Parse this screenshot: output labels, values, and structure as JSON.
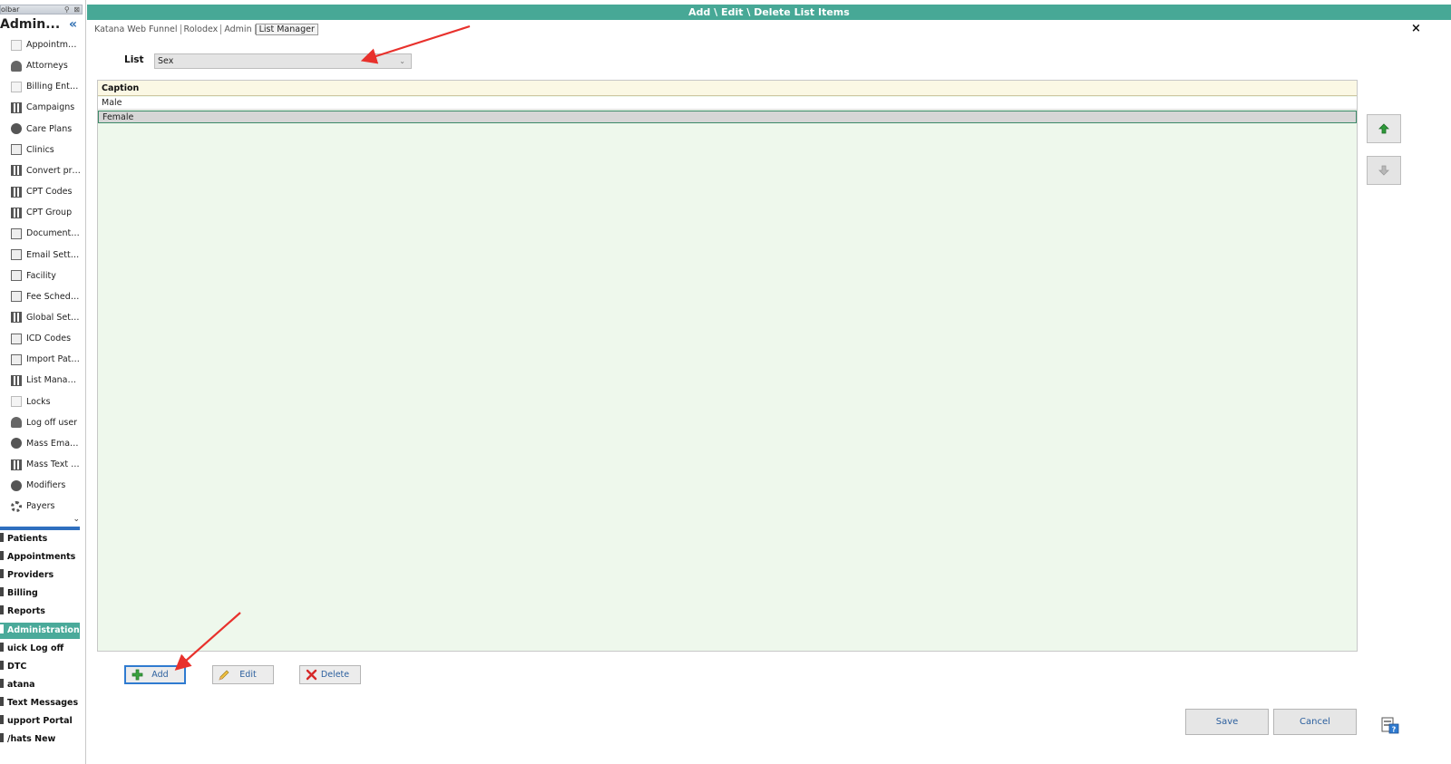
{
  "sidebar": {
    "toolbar_label": "olbar",
    "title": "Admin...",
    "collapse_glyph": "«",
    "items": [
      {
        "label": "Appointment...",
        "icon": "calendar-icon"
      },
      {
        "label": "Attorneys",
        "icon": "people-icon"
      },
      {
        "label": "Billing Entities",
        "icon": "billing-icon"
      },
      {
        "label": "Campaigns",
        "icon": "campaigns-icon"
      },
      {
        "label": "Care Plans",
        "icon": "care-plans-icon"
      },
      {
        "label": "Clinics",
        "icon": "building-icon"
      },
      {
        "label": "Convert pros...",
        "icon": "convert-icon"
      },
      {
        "label": "CPT Codes",
        "icon": "codes-icon"
      },
      {
        "label": "CPT Group",
        "icon": "group-icon"
      },
      {
        "label": "Document T...",
        "icon": "chart-icon"
      },
      {
        "label": "Email Settings",
        "icon": "tag-icon"
      },
      {
        "label": "Facility",
        "icon": "facility-icon"
      },
      {
        "label": "Fee Schedules",
        "icon": "fee-icon"
      },
      {
        "label": "Global Settin...",
        "icon": "settings-grid-icon"
      },
      {
        "label": "ICD Codes",
        "icon": "monitor-icon"
      },
      {
        "label": "Import Patie...",
        "icon": "import-icon"
      },
      {
        "label": "List Manager",
        "icon": "list-icon"
      },
      {
        "label": "Locks",
        "icon": "lock-icon"
      },
      {
        "label": "Log off user",
        "icon": "user-logoff-icon"
      },
      {
        "label": "Mass Email S...",
        "icon": "mass-email-icon"
      },
      {
        "label": "Mass Text S...",
        "icon": "mass-text-icon"
      },
      {
        "label": "Modifiers",
        "icon": "modifiers-icon"
      },
      {
        "label": "Payers",
        "icon": "gear-icon"
      }
    ],
    "scroll_glyph": "⌄",
    "nav": [
      {
        "label": "Patients",
        "active": false
      },
      {
        "label": "Appointments",
        "active": false
      },
      {
        "label": "Providers",
        "active": false
      },
      {
        "label": "Billing",
        "active": false
      },
      {
        "label": "Reports",
        "active": false
      },
      {
        "label": "Administration",
        "active": true
      },
      {
        "label": "uick Log off",
        "active": false
      },
      {
        "label": "DTC",
        "active": false
      },
      {
        "label": "atana",
        "active": false
      },
      {
        "label": "Text Messages",
        "active": false
      },
      {
        "label": "upport Portal",
        "active": false
      },
      {
        "label": "/hats New",
        "active": false
      }
    ]
  },
  "header": {
    "title": "Add \\ Edit \\ Delete List Items",
    "close_glyph": "×"
  },
  "breadcrumb": [
    "Katana Web Funnel",
    "Rolodex",
    "Admin",
    "List Manager"
  ],
  "list_selector": {
    "label": "List",
    "value": "Sex",
    "arrow": "⌄"
  },
  "grid": {
    "column": "Caption",
    "rows": [
      {
        "caption": "Male",
        "selected": false
      },
      {
        "caption": "Female",
        "selected": true
      }
    ]
  },
  "actions": {
    "add": "Add",
    "edit": "Edit",
    "delete": "Delete"
  },
  "footer": {
    "save": "Save",
    "cancel": "Cancel"
  },
  "colors": {
    "accent": "#47a896",
    "active_nav": "#4aaa9a",
    "grid_bg": "#eef8ec",
    "header_bg": "#fbf8e4",
    "annotation_arrow": "#e8312c"
  }
}
